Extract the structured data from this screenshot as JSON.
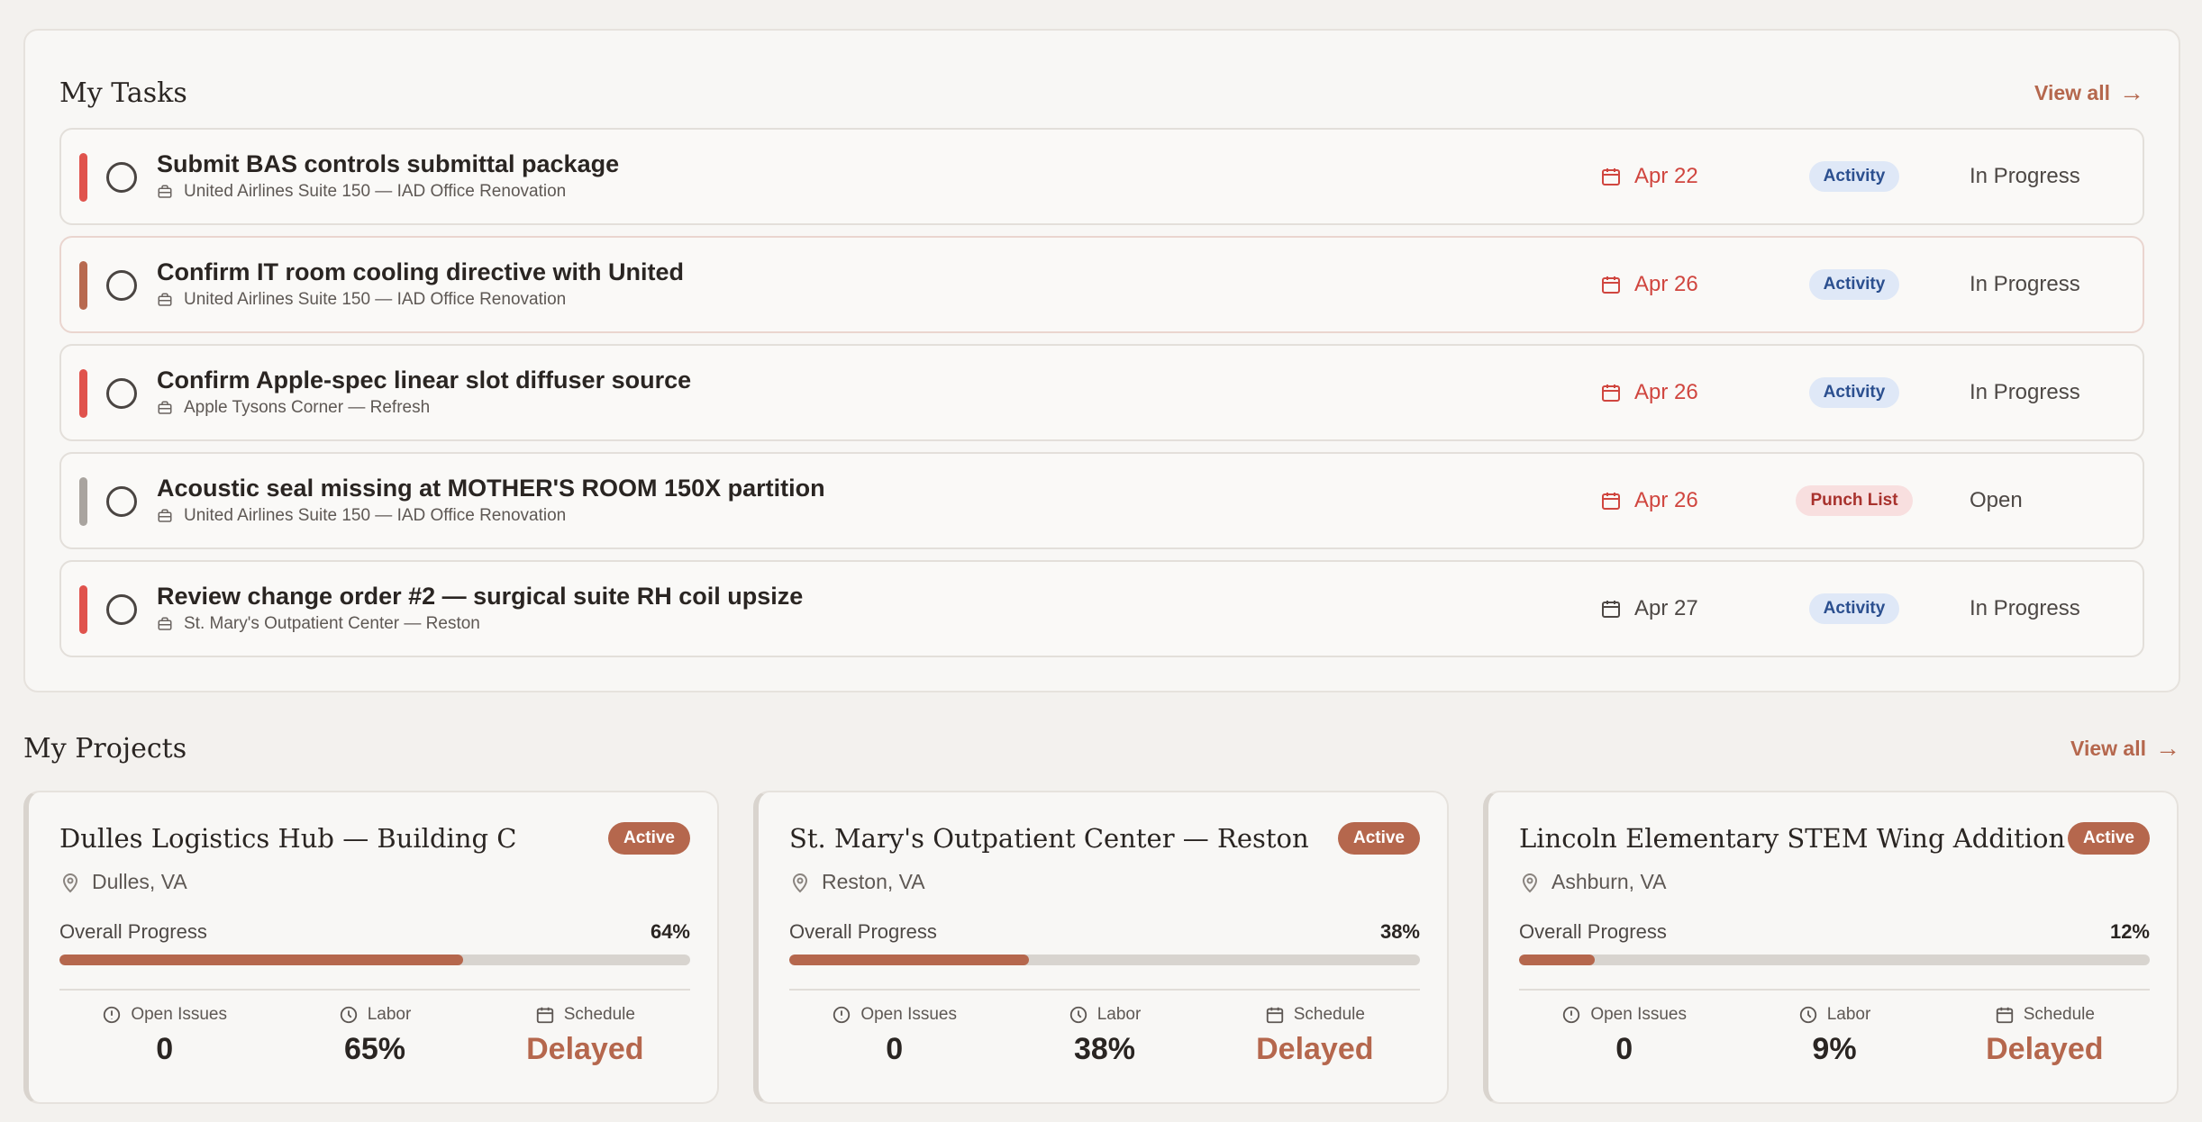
{
  "tasks": {
    "title": "My Tasks",
    "view_all": "View all",
    "items": [
      {
        "title": "Submit BAS controls submittal package",
        "project": "United Airlines Suite 150 — IAD Office Renovation",
        "due": "Apr 22",
        "type": "Activity",
        "status": "In Progress",
        "priority_color": "#e0534d",
        "overdue": true
      },
      {
        "title": "Confirm IT room cooling directive with United",
        "project": "United Airlines Suite 150 — IAD Office Renovation",
        "due": "Apr 26",
        "type": "Activity",
        "status": "In Progress",
        "priority_color": "#b86a50",
        "overdue": true
      },
      {
        "title": "Confirm Apple-spec linear slot diffuser source",
        "project": "Apple Tysons Corner — Refresh",
        "due": "Apr 26",
        "type": "Activity",
        "status": "In Progress",
        "priority_color": "#e0534d",
        "overdue": true
      },
      {
        "title": "Acoustic seal missing at MOTHER'S ROOM 150X partition",
        "project": "United Airlines Suite 150 — IAD Office Renovation",
        "due": "Apr 26",
        "type": "Punch List",
        "status": "Open",
        "priority_color": "#a9a49f",
        "overdue": true
      },
      {
        "title": "Review change order #2 — surgical suite RH coil upsize",
        "project": "St. Mary's Outpatient Center — Reston",
        "due": "Apr 27",
        "type": "Activity",
        "status": "In Progress",
        "priority_color": "#e0534d",
        "overdue": false
      }
    ]
  },
  "projects": {
    "title": "My Projects",
    "view_all": "View all",
    "labels": {
      "overall_progress": "Overall Progress",
      "open_issues": "Open Issues",
      "labor": "Labor",
      "schedule": "Schedule"
    },
    "items": [
      {
        "name": "Dulles Logistics Hub — Building C",
        "location": "Dulles, VA",
        "status": "Active",
        "progress": 64,
        "progress_text": "64%",
        "open_issues": "0",
        "labor": "65%",
        "schedule": "Delayed"
      },
      {
        "name": "St. Mary's Outpatient Center — Reston",
        "location": "Reston, VA",
        "status": "Active",
        "progress": 38,
        "progress_text": "38%",
        "open_issues": "0",
        "labor": "38%",
        "schedule": "Delayed"
      },
      {
        "name": "Lincoln Elementary STEM Wing Addition",
        "location": "Ashburn, VA",
        "status": "Active",
        "progress": 12,
        "progress_text": "12%",
        "open_issues": "0",
        "labor": "9%",
        "schedule": "Delayed"
      }
    ]
  },
  "colors": {
    "accent": "#b5674d",
    "overdue": "#d0463f",
    "activity_bg": "#dfe8f7",
    "punch_bg": "#f8dfdf"
  },
  "icons": {
    "task_project": "briefcase-icon",
    "due": "calendar-icon",
    "location": "map-pin-icon",
    "issues": "alert-circle-icon",
    "labor": "clock-icon",
    "schedule": "calendar-icon"
  }
}
